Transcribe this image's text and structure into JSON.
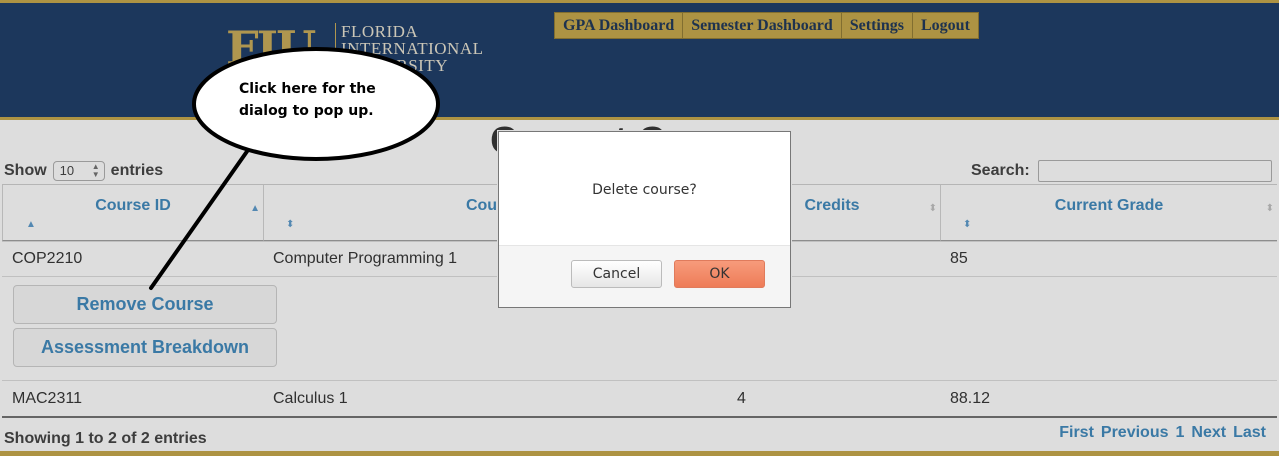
{
  "header": {
    "logo_mark": "FIU",
    "logo_lines": [
      "FLORIDA",
      "INTERNATIONAL",
      "UNIVERSITY"
    ],
    "nav": [
      "GPA Dashboard",
      "Semester Dashboard",
      "Settings",
      "Logout"
    ],
    "brand_color": "#082B5A",
    "accent_color": "#C2A13A"
  },
  "page": {
    "title": "Current Courses"
  },
  "table_controls": {
    "show_label": "Show",
    "length_value": "10",
    "entries_label": "entries",
    "search_label": "Search:",
    "search_value": ""
  },
  "table": {
    "columns": [
      "Course ID",
      "Course",
      "Credits",
      "Current Grade"
    ],
    "rows": [
      {
        "course_id": "COP2210",
        "course": "Computer Programming 1",
        "credits": "",
        "grade": "85"
      },
      {
        "course_id": "MAC2311",
        "course": "Calculus 1",
        "credits": "4",
        "grade": "88.12"
      }
    ],
    "row_actions": [
      "Remove Course",
      "Assessment Breakdown"
    ],
    "info": "Showing 1 to 2 of 2 entries",
    "pagination": [
      "First",
      "Previous",
      "1",
      "Next",
      "Last"
    ]
  },
  "dialog": {
    "message": "Delete course?",
    "cancel_label": "Cancel",
    "ok_label": "OK"
  },
  "callout": {
    "text": "Click here for the dialog to pop up."
  }
}
